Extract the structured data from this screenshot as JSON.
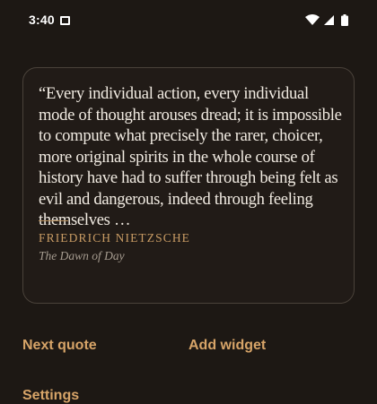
{
  "status_bar": {
    "time": "3:40",
    "icons": [
      "notification-icon",
      "wifi-icon",
      "signal-icon",
      "battery-icon"
    ]
  },
  "quote_card": {
    "quote": "“Every individual action, every individual mode of thought arouses dread; it is impossible to compute what precisely the rarer, choicer, more original spirits in the whole course of history have had to suffer through being felt as evil and dangerous, indeed through feeling themselves …",
    "author": "Friedrich Nietzsche",
    "source": "The Dawn of Day"
  },
  "actions": {
    "next_quote": "Next quote",
    "add_widget": "Add widget",
    "settings": "Settings"
  },
  "colors": {
    "background": "#1d1814",
    "card_background": "#211b17",
    "card_border": "#4a423a",
    "accent": "#d7a468",
    "author": "#c99c64",
    "quote_text": "#f1ebe2",
    "source_text": "#a59b8f"
  }
}
